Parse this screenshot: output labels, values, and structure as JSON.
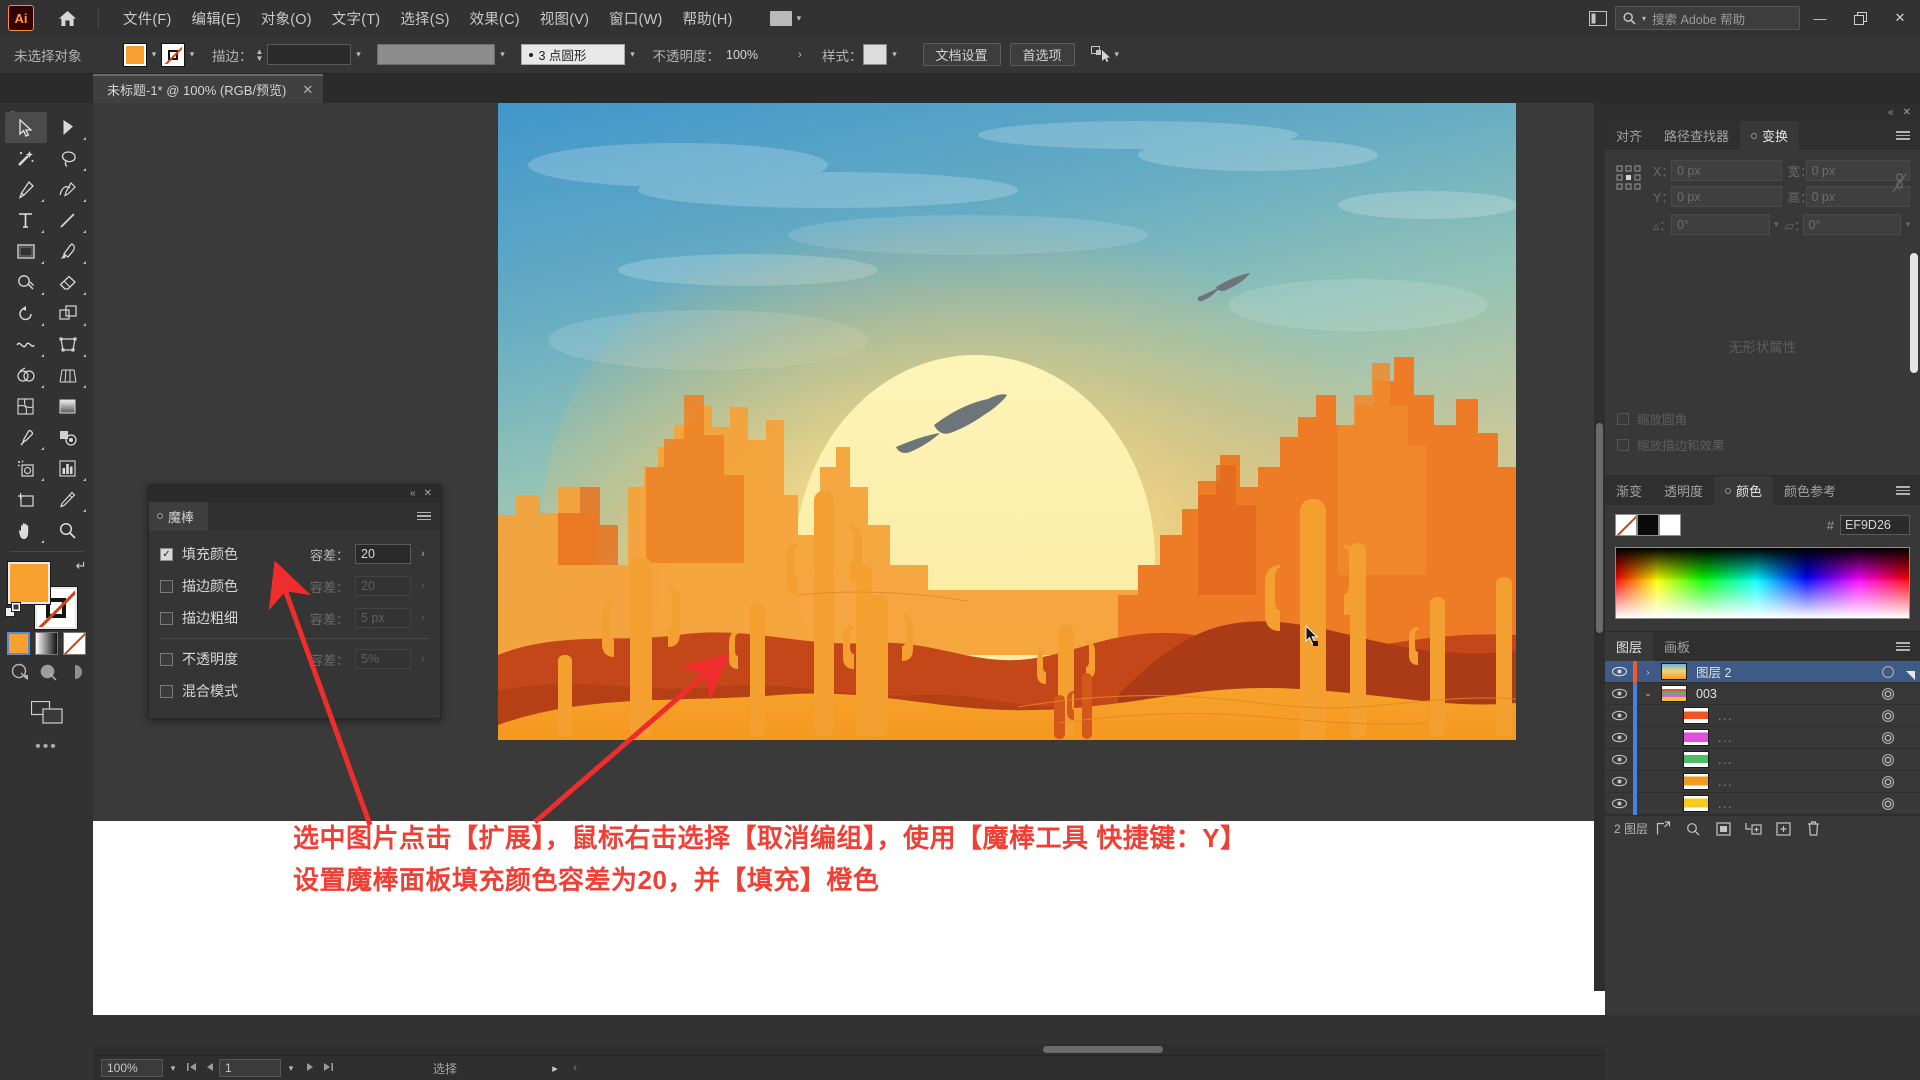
{
  "app": {
    "name": "Adobe Illustrator",
    "logo_text": "Ai"
  },
  "menubar": {
    "items": [
      "文件(F)",
      "编辑(E)",
      "对象(O)",
      "文字(T)",
      "选择(S)",
      "效果(C)",
      "视图(V)",
      "窗口(W)",
      "帮助(H)"
    ],
    "search_placeholder": "搜索 Adobe 帮助",
    "minimize": "—",
    "maximize": "❐",
    "close": "✕"
  },
  "controlbar": {
    "selection_status": "未选择对象",
    "fill_color": "#F7A02E",
    "stroke_label": "描边：",
    "stroke_weight": "",
    "brush_profile": "3 点圆形",
    "opacity_label": "不透明度：",
    "opacity_value": "100%",
    "style_label": "样式：",
    "doc_setup": "文档设置",
    "preferences": "首选项"
  },
  "document": {
    "tab_title": "未标题-1* @ 100% (RGB/预览)",
    "tab_close": "✕"
  },
  "wand_panel": {
    "tab_label": "魔棒",
    "close": "✕",
    "collapse": "«",
    "rows": [
      {
        "label": "填充颜色",
        "checked": true,
        "tol_label": "容差：",
        "tol_value": "20",
        "enabled": true
      },
      {
        "label": "描边颜色",
        "checked": false,
        "tol_label": "容差：",
        "tol_value": "20",
        "enabled": false
      },
      {
        "label": "描边粗细",
        "checked": false,
        "tol_label": "容差：",
        "tol_value": "5 px",
        "enabled": false
      },
      {
        "label": "不透明度",
        "checked": false,
        "tol_label": "容差：",
        "tol_value": "5%",
        "enabled": false
      },
      {
        "label": "混合模式",
        "checked": false,
        "tol_label": "",
        "tol_value": "",
        "enabled": false
      }
    ]
  },
  "transform_panel": {
    "tabs": [
      {
        "label": "对齐",
        "active": false
      },
      {
        "label": "路径查找器",
        "active": false
      },
      {
        "label": "变换",
        "active": true
      }
    ],
    "x_label": "X：",
    "x_value": "0 px",
    "y_label": "Y：",
    "y_value": "0 px",
    "w_label": "宽：",
    "w_value": "0 px",
    "h_label": "高：",
    "h_value": "0 px",
    "angle_label": "▵：",
    "angle_value": "0°",
    "shear_label": "▱：",
    "shear_value": "0°",
    "empty_text": "无形状属性",
    "check_scale_corners": "缩放圆角",
    "check_scale_strokes": "缩放描边和效果"
  },
  "color_panel": {
    "tabs": [
      {
        "label": "渐变",
        "active": false
      },
      {
        "label": "透明度",
        "active": false
      },
      {
        "label": "颜色",
        "active": true
      },
      {
        "label": "颜色参考",
        "active": false
      }
    ],
    "hash": "#",
    "hex_value": "EF9D26"
  },
  "layers_panel": {
    "tabs": [
      {
        "label": "图层",
        "active": true
      },
      {
        "label": "画板",
        "active": false
      }
    ],
    "rows": [
      {
        "name": "图层 2",
        "selected": true,
        "indent": 0,
        "color": "#f05a28",
        "thumb": "sunset",
        "expander": "›"
      },
      {
        "name": "003",
        "selected": false,
        "indent": 0,
        "color": "#4a7ee8",
        "thumb": "multi",
        "expander": "⌄"
      },
      {
        "name": "...",
        "selected": false,
        "indent": 1,
        "color": "#4a7ee8",
        "thumb": "orange",
        "expander": ""
      },
      {
        "name": "...",
        "selected": false,
        "indent": 1,
        "color": "#4a7ee8",
        "thumb": "magenta",
        "expander": ""
      },
      {
        "name": "...",
        "selected": false,
        "indent": 1,
        "color": "#4a7ee8",
        "thumb": "green",
        "expander": ""
      },
      {
        "name": "...",
        "selected": false,
        "indent": 1,
        "color": "#4a7ee8",
        "thumb": "amber",
        "expander": ""
      },
      {
        "name": "...",
        "selected": false,
        "indent": 1,
        "color": "#4a7ee8",
        "thumb": "yellow",
        "expander": ""
      }
    ],
    "footer_count": "2 图层"
  },
  "statusbar": {
    "zoom": "100%",
    "page": "1",
    "status_text": "选择",
    "nav_first": "⏮",
    "nav_prev": "◂",
    "nav_next": "▸",
    "nav_last": "⏭",
    "status_caret": "▸",
    "status_prev": "‹"
  },
  "annotation": {
    "line1": "选中图片点击【扩展】，鼠标右击选择【取消编组】，使用【魔棒工具 快捷键：Y】",
    "line2": "设置魔棒面板填充颜色容差为20，并【填充】橙色",
    "color": "#EF4036"
  },
  "toolbar": {
    "tools": [
      "selection-tool",
      "direct-selection-tool",
      "magic-wand-tool",
      "lasso-tool",
      "pen-tool",
      "curvature-tool",
      "type-tool",
      "line-segment-tool",
      "rectangle-tool",
      "paintbrush-tool",
      "shaper-tool",
      "eraser-tool",
      "rotate-tool",
      "scale-tool",
      "width-tool",
      "free-transform-tool",
      "shape-builder-tool",
      "perspective-grid-tool",
      "mesh-tool",
      "gradient-tool",
      "eyedropper-tool",
      "blend-tool",
      "symbol-sprayer-tool",
      "column-graph-tool",
      "artboard-tool",
      "slice-tool",
      "hand-tool",
      "zoom-tool"
    ],
    "fill_color": "#F7A02E",
    "stroke_color": "#FFFFFF",
    "more_tools": "•••"
  },
  "artwork": {
    "title": "Desert sunset illustration",
    "sky_top": "#4A9FD0",
    "sky_mid": "#8FC4C4",
    "sun_glow": "#F3D27A",
    "sun_core": "#FAF0A8",
    "dune_front": "#F59B22",
    "dune_mid": "#E0601E",
    "dune_dark": "#C44417",
    "mesa_light": "#F7A53C",
    "mesa_mid": "#EE7A24",
    "cactus": "#F5A033"
  }
}
